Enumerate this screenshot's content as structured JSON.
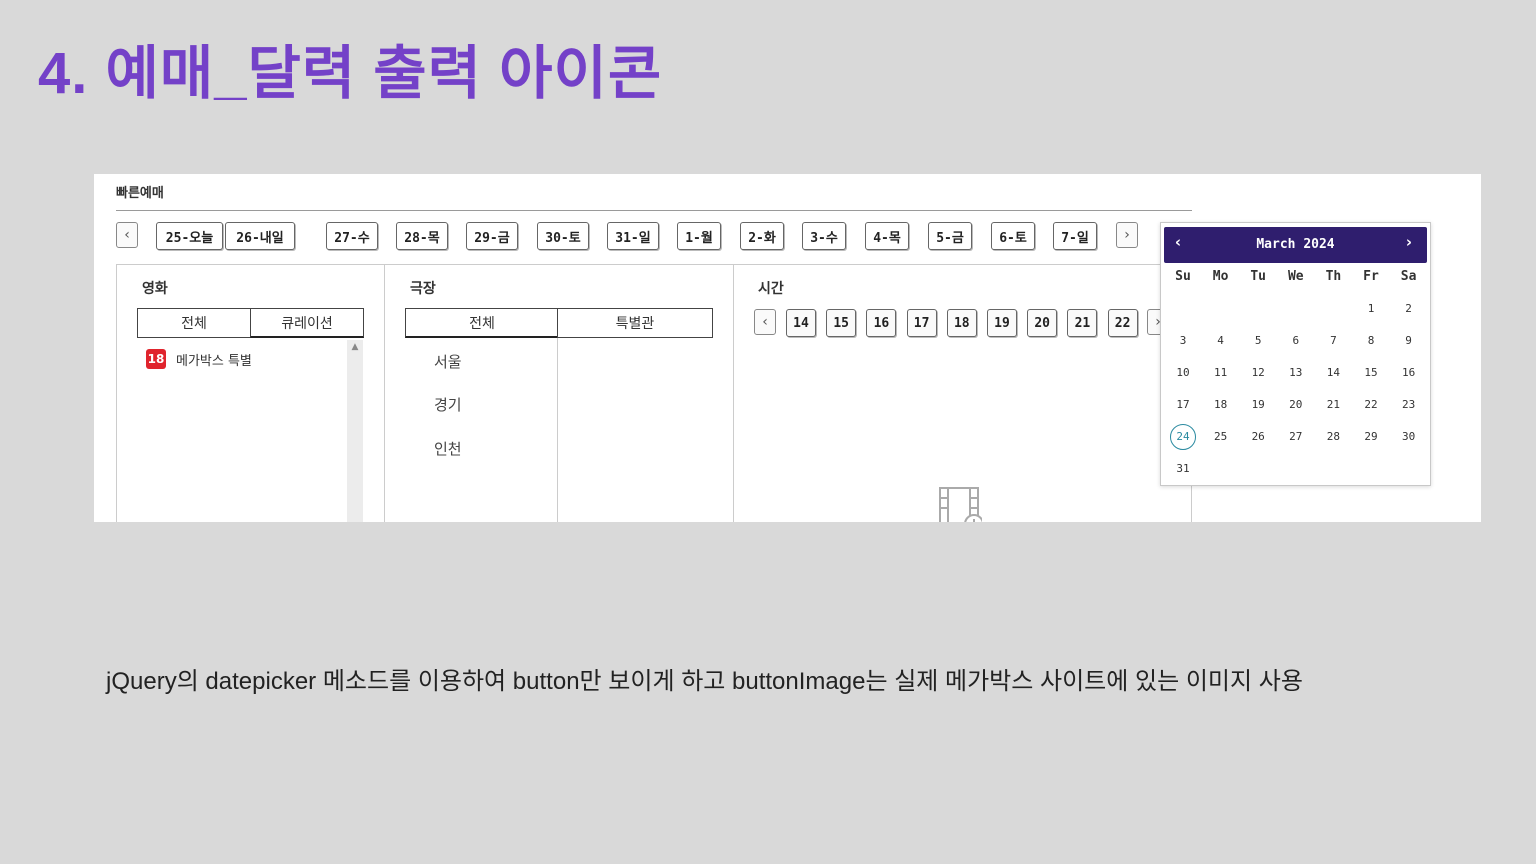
{
  "slide": {
    "title": "4. 예매_달력 출력 아이콘",
    "caption": "jQuery의 datepicker 메소드를 이용하여 button만 보이게 하고 buttonImage는 실제 메가박스 사이트에 있는 이미지 사용"
  },
  "booking": {
    "title": "빠른예매",
    "nav_prev": "‹",
    "nav_next": "›",
    "dates": [
      "25-오늘",
      "26-내일",
      "27-수",
      "28-목",
      "29-금",
      "30-토",
      "31-일",
      "1-월",
      "2-화",
      "3-수",
      "4-목",
      "5-금",
      "6-토",
      "7-일"
    ],
    "movie_panel": {
      "heading": "영화",
      "tabs": [
        "전체",
        "큐레이션"
      ],
      "age_rating": "18",
      "movie": "메가박스 특별",
      "scroll_up": "▲"
    },
    "theater_panel": {
      "heading": "극장",
      "tabs": [
        "전체",
        "특별관"
      ],
      "regions": [
        "서울",
        "경기",
        "인천"
      ]
    },
    "time_panel": {
      "heading": "시간",
      "hours": [
        "14",
        "15",
        "16",
        "17",
        "18",
        "19",
        "20",
        "21",
        "22"
      ],
      "empty_icon": "film-clock-icon"
    }
  },
  "datepicker": {
    "month_title": "March 2024",
    "prev": "‹",
    "next": "›",
    "weekdays": [
      "Su",
      "Mo",
      "Tu",
      "We",
      "Th",
      "Fr",
      "Sa"
    ],
    "first_weekday_index": 5,
    "days_in_month": 31,
    "today": 24,
    "header_color": "#2f1e6e",
    "today_color": "#2a8aa0"
  },
  "colors": {
    "title": "#7441c8",
    "background": "#d9d9d9"
  }
}
